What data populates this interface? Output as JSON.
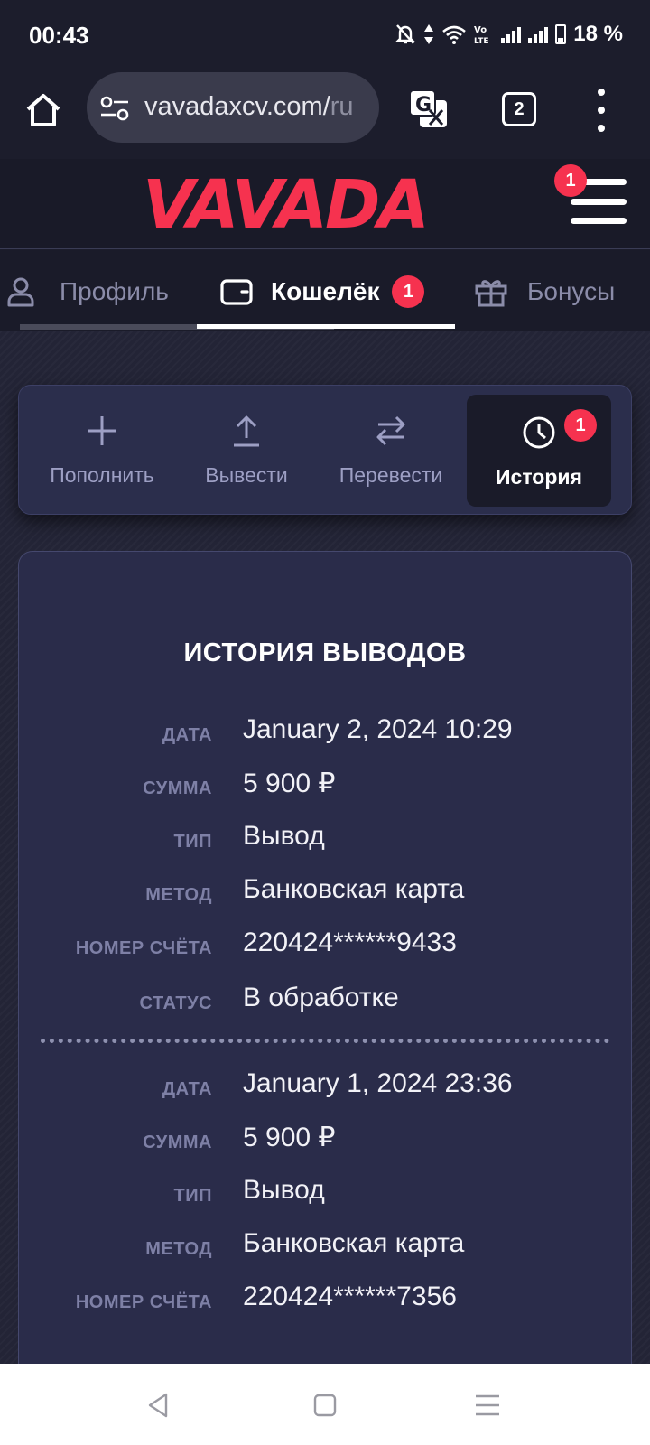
{
  "status_bar": {
    "time": "00:43",
    "battery": "18 %",
    "icons": [
      "notifications-muted-icon",
      "data-arrows-icon",
      "wifi-icon",
      "volte-icon",
      "signal-icon",
      "signal-icon",
      "battery-icon"
    ]
  },
  "browser": {
    "url_host": "vavadaxcv.com/",
    "url_path_fragment": "ru",
    "tab_count": "2"
  },
  "site": {
    "logo": "VAVADA",
    "menu_badge": "1"
  },
  "account_tabs": [
    {
      "label": "Профиль",
      "icon": "user-icon",
      "active": false
    },
    {
      "label": "Кошелёк",
      "icon": "wallet-icon",
      "active": true,
      "badge": "1"
    },
    {
      "label": "Бонусы",
      "icon": "gift-icon",
      "active": false
    }
  ],
  "wallet_actions": [
    {
      "label": "Пополнить",
      "icon": "plus-icon"
    },
    {
      "label": "Вывести",
      "icon": "upload-icon"
    },
    {
      "label": "Перевести",
      "icon": "transfer-icon"
    },
    {
      "label": "История",
      "icon": "clock-icon",
      "active": true,
      "badge": "1"
    }
  ],
  "history": {
    "title": "ИСТОРИЯ ВЫВОДОВ",
    "labels": {
      "date": "ДАТА",
      "amount": "СУММА",
      "type": "ТИП",
      "method": "МЕТОД",
      "account": "НОМЕР СЧЁТА",
      "status": "СТАТУС"
    },
    "records": [
      {
        "date": "January 2, 2024 10:29",
        "amount": "5 900 ₽",
        "type": "Вывод",
        "method": "Банковская карта",
        "account": "220424******9433",
        "status": "В обработке"
      },
      {
        "date": "January 1, 2024 23:36",
        "amount": "5 900 ₽",
        "type": "Вывод",
        "method": "Банковская карта",
        "account": "220424******7356"
      }
    ]
  },
  "colors": {
    "accent": "#f6324f",
    "background": "#1c1d2c",
    "card": "#2a2c4a",
    "label": "#7e80a6"
  }
}
